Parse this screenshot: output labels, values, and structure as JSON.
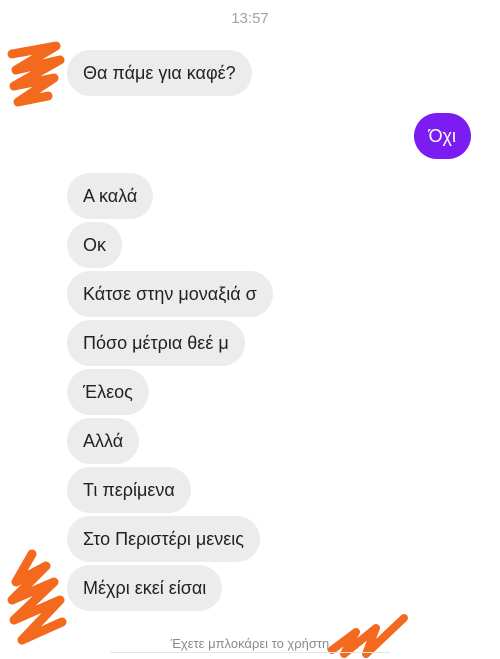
{
  "chat": {
    "timestamp": "13:57",
    "messages": [
      {
        "direction": "incoming",
        "text": "Θα πάμε για καφέ?"
      },
      {
        "direction": "outgoing",
        "text": "Όχι"
      },
      {
        "direction": "incoming",
        "text": "Α καλά"
      },
      {
        "direction": "incoming",
        "text": "Οκ"
      },
      {
        "direction": "incoming",
        "text": "Κάτσε στην μοναξιά σ"
      },
      {
        "direction": "incoming",
        "text": "Πόσο μέτρια θεέ μ"
      },
      {
        "direction": "incoming",
        "text": "Έλεος"
      },
      {
        "direction": "incoming",
        "text": "Αλλά"
      },
      {
        "direction": "incoming",
        "text": "Τι περίμενα"
      },
      {
        "direction": "incoming",
        "text": "Στο Περιστέρι μενεις"
      },
      {
        "direction": "incoming",
        "text": "Μέχρι εκεί είσαι"
      }
    ],
    "blocked_notice": "Έχετε μπλοκάρει το χρήστη"
  },
  "colors": {
    "outgoing_bubble": "#7a1cf2",
    "incoming_bubble": "#ececec",
    "redaction": "#f36a1f"
  },
  "icons": {
    "avatar_redaction": "orange-scribble"
  }
}
